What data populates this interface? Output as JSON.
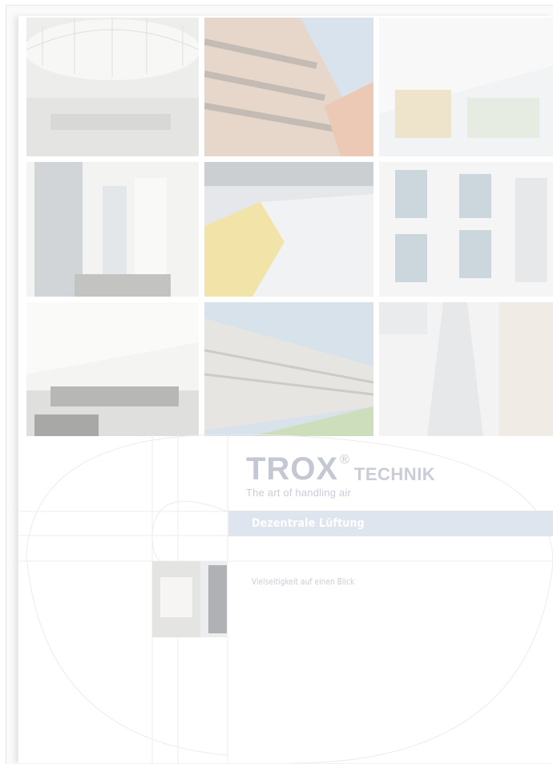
{
  "brand": {
    "logo_text": "TROX",
    "registered": "®",
    "logo_suffix": "TECHNIK",
    "tagline": "The art of handling air"
  },
  "document": {
    "title": "Dezentrale Lüftung",
    "subtitle": "Vielseitigkeit auf einen Blick"
  },
  "colors": {
    "title_bar": "#dfe5ef",
    "logo": "#c3c8d4"
  }
}
